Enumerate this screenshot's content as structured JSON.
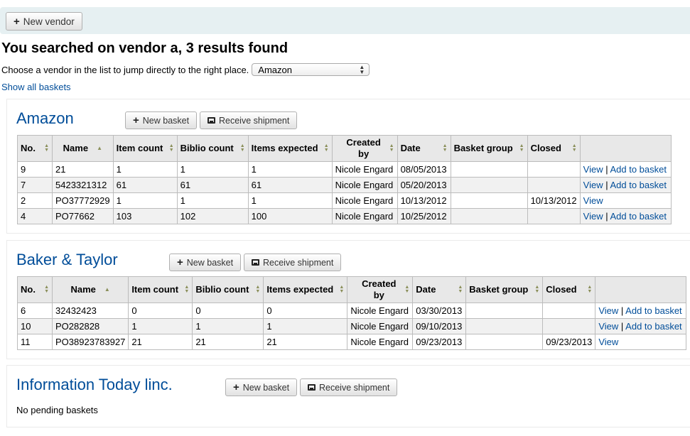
{
  "toolbar": {
    "new_vendor_label": "New vendor"
  },
  "heading": "You searched on vendor a, 3 results found",
  "choose": {
    "label": "Choose a vendor in the list to jump directly to the right place.",
    "selected": "Amazon"
  },
  "show_all_label": "Show all baskets",
  "buttons": {
    "new_basket": "New basket",
    "receive_shipment": "Receive shipment"
  },
  "columns": [
    "No.",
    "Name",
    "Item count",
    "Biblio count",
    "Items expected",
    "Created by",
    "Date",
    "Basket group",
    "Closed"
  ],
  "vendors": [
    {
      "name": "Amazon",
      "rows": [
        {
          "no": "9",
          "name": "21",
          "item_count": "1",
          "biblio_count": "1",
          "items_expected": "1",
          "created_by": "Nicole Engard",
          "date": "08/05/2013",
          "basket_group": "",
          "closed": "",
          "view": "View",
          "add": "Add to basket"
        },
        {
          "no": "7",
          "name": "5423321312",
          "item_count": "61",
          "biblio_count": "61",
          "items_expected": "61",
          "created_by": "Nicole Engard",
          "date": "05/20/2013",
          "basket_group": "",
          "closed": "",
          "view": "View",
          "add": "Add to basket"
        },
        {
          "no": "2",
          "name": "PO37772929",
          "item_count": "1",
          "biblio_count": "1",
          "items_expected": "1",
          "created_by": "Nicole Engard",
          "date": "10/13/2012",
          "basket_group": "",
          "closed": "10/13/2012",
          "view": "View",
          "add": ""
        },
        {
          "no": "4",
          "name": "PO77662",
          "item_count": "103",
          "biblio_count": "102",
          "items_expected": "100",
          "created_by": "Nicole Engard",
          "date": "10/25/2012",
          "basket_group": "",
          "closed": "",
          "view": "View",
          "add": "Add to basket"
        }
      ]
    },
    {
      "name": "Baker & Taylor",
      "rows": [
        {
          "no": "6",
          "name": "32432423",
          "item_count": "0",
          "biblio_count": "0",
          "items_expected": "0",
          "created_by": "Nicole Engard",
          "date": "03/30/2013",
          "basket_group": "",
          "closed": "",
          "view": "View",
          "add": "Add to basket"
        },
        {
          "no": "10",
          "name": "PO282828",
          "item_count": "1",
          "biblio_count": "1",
          "items_expected": "1",
          "created_by": "Nicole Engard",
          "date": "09/10/2013",
          "basket_group": "",
          "closed": "",
          "view": "View",
          "add": "Add to basket"
        },
        {
          "no": "11",
          "name": "PO38923783927",
          "item_count": "21",
          "biblio_count": "21",
          "items_expected": "21",
          "created_by": "Nicole Engard",
          "date": "09/23/2013",
          "basket_group": "",
          "closed": "09/23/2013",
          "view": "View",
          "add": ""
        }
      ]
    },
    {
      "name": "Information Today linc.",
      "rows": [],
      "empty_text": "No pending baskets"
    }
  ],
  "colors": {
    "link": "#004d99",
    "toolbar_bg": "#e6f0f2",
    "header_bg": "#e8e8e8",
    "row_alt_bg": "#f1f1f1"
  },
  "icons": {
    "add": "plus-icon",
    "receive": "tray-icon",
    "sort": "sort-arrows-icon"
  }
}
